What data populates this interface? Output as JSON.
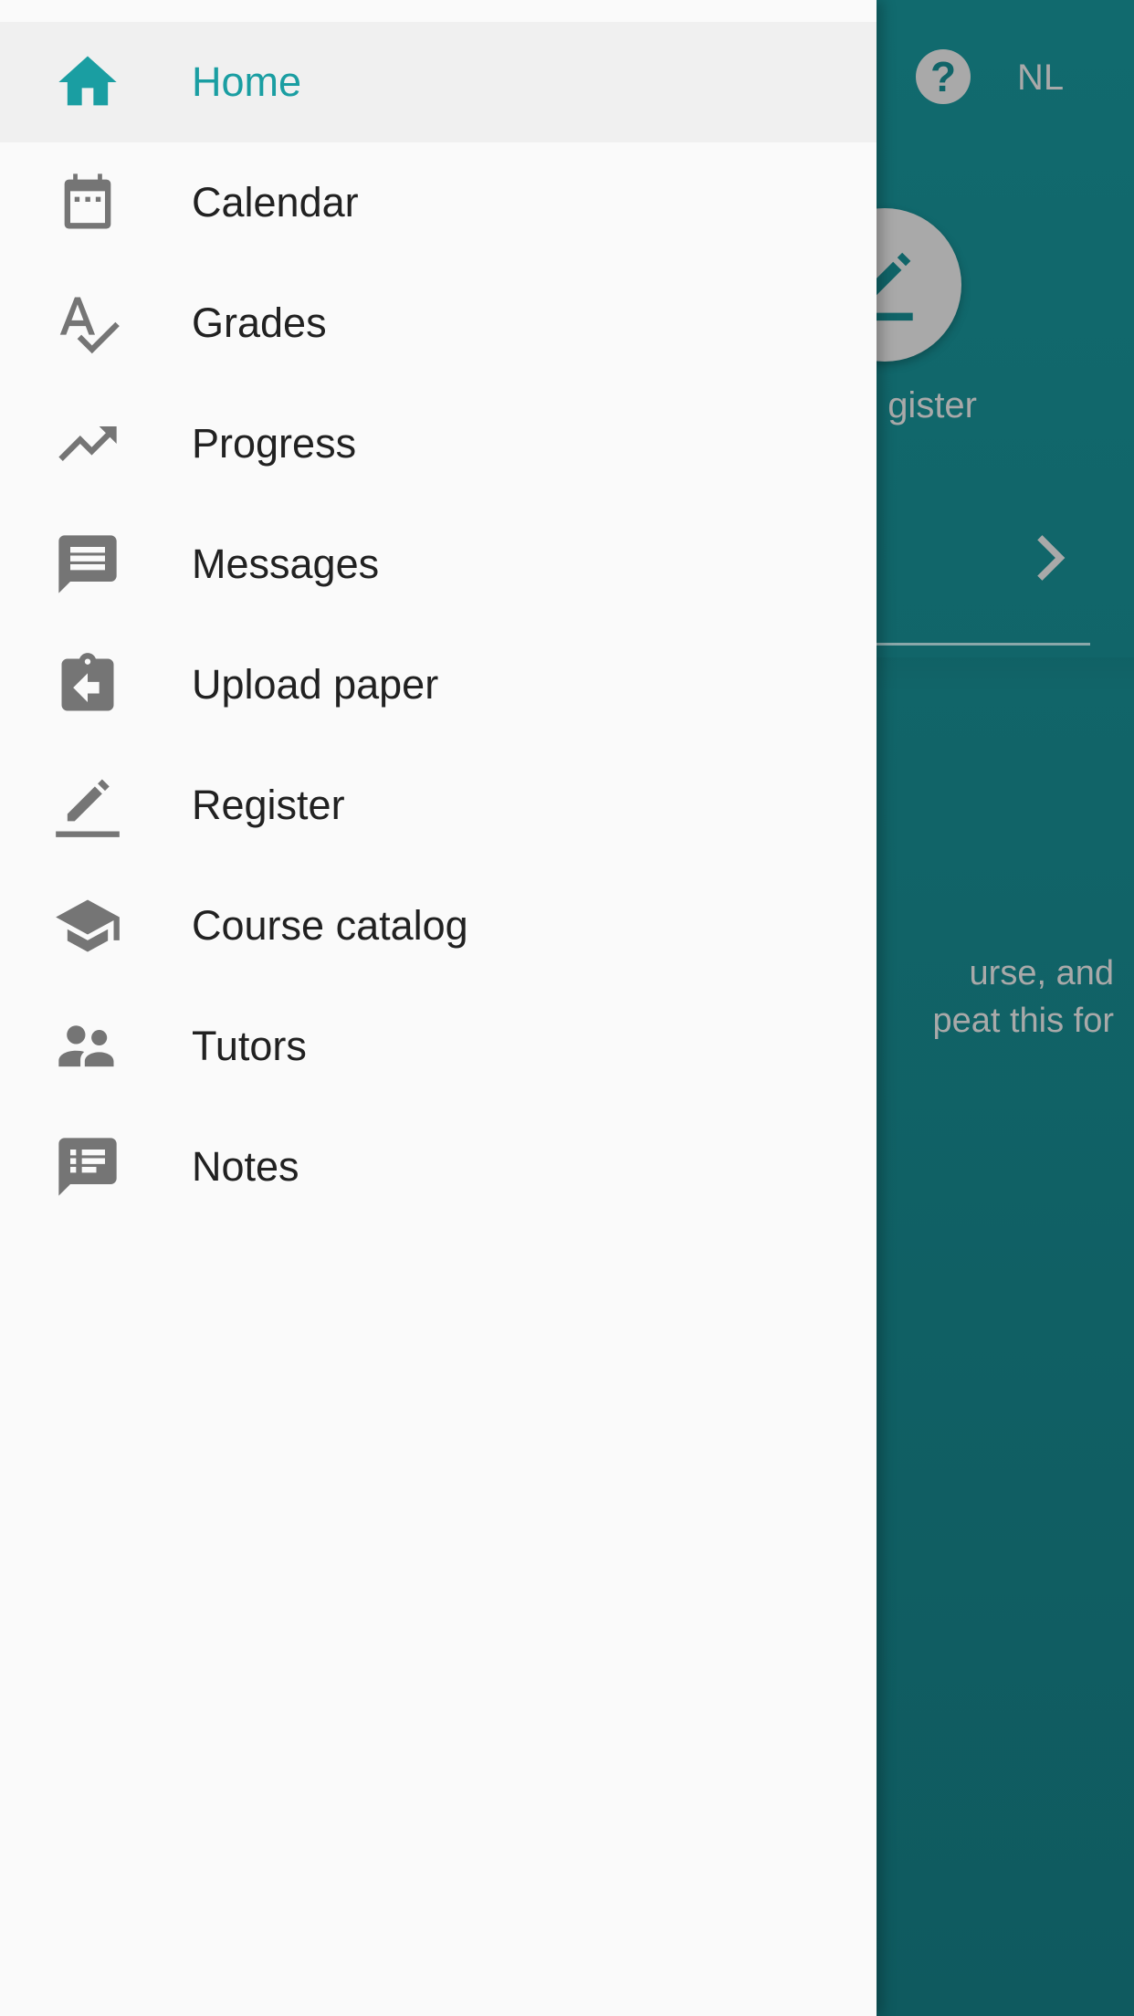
{
  "colors": {
    "accent": "#1a9ea2",
    "icon_gray": "#757575",
    "text_dark": "#212121",
    "app_bg": "#106468",
    "scrim_text": "#a9a9a9"
  },
  "drawer": {
    "items": [
      {
        "label": "Home",
        "icon": "home-icon",
        "active": true
      },
      {
        "label": "Calendar",
        "icon": "calendar-icon",
        "active": false
      },
      {
        "label": "Grades",
        "icon": "spellcheck-icon",
        "active": false
      },
      {
        "label": "Progress",
        "icon": "trending-up-icon",
        "active": false
      },
      {
        "label": "Messages",
        "icon": "message-icon",
        "active": false
      },
      {
        "label": "Upload paper",
        "icon": "assignment-return-icon",
        "active": false
      },
      {
        "label": "Register",
        "icon": "edit-underline-icon",
        "active": false
      },
      {
        "label": "Course catalog",
        "icon": "school-icon",
        "active": false
      },
      {
        "label": "Tutors",
        "icon": "people-icon",
        "active": false
      },
      {
        "label": "Notes",
        "icon": "speaker-notes-icon",
        "active": false
      }
    ]
  },
  "background": {
    "help_icon": "?",
    "language": "NL",
    "register_label": "gister",
    "info_text_line1": "urse, and",
    "info_text_line2": "peat this for"
  }
}
